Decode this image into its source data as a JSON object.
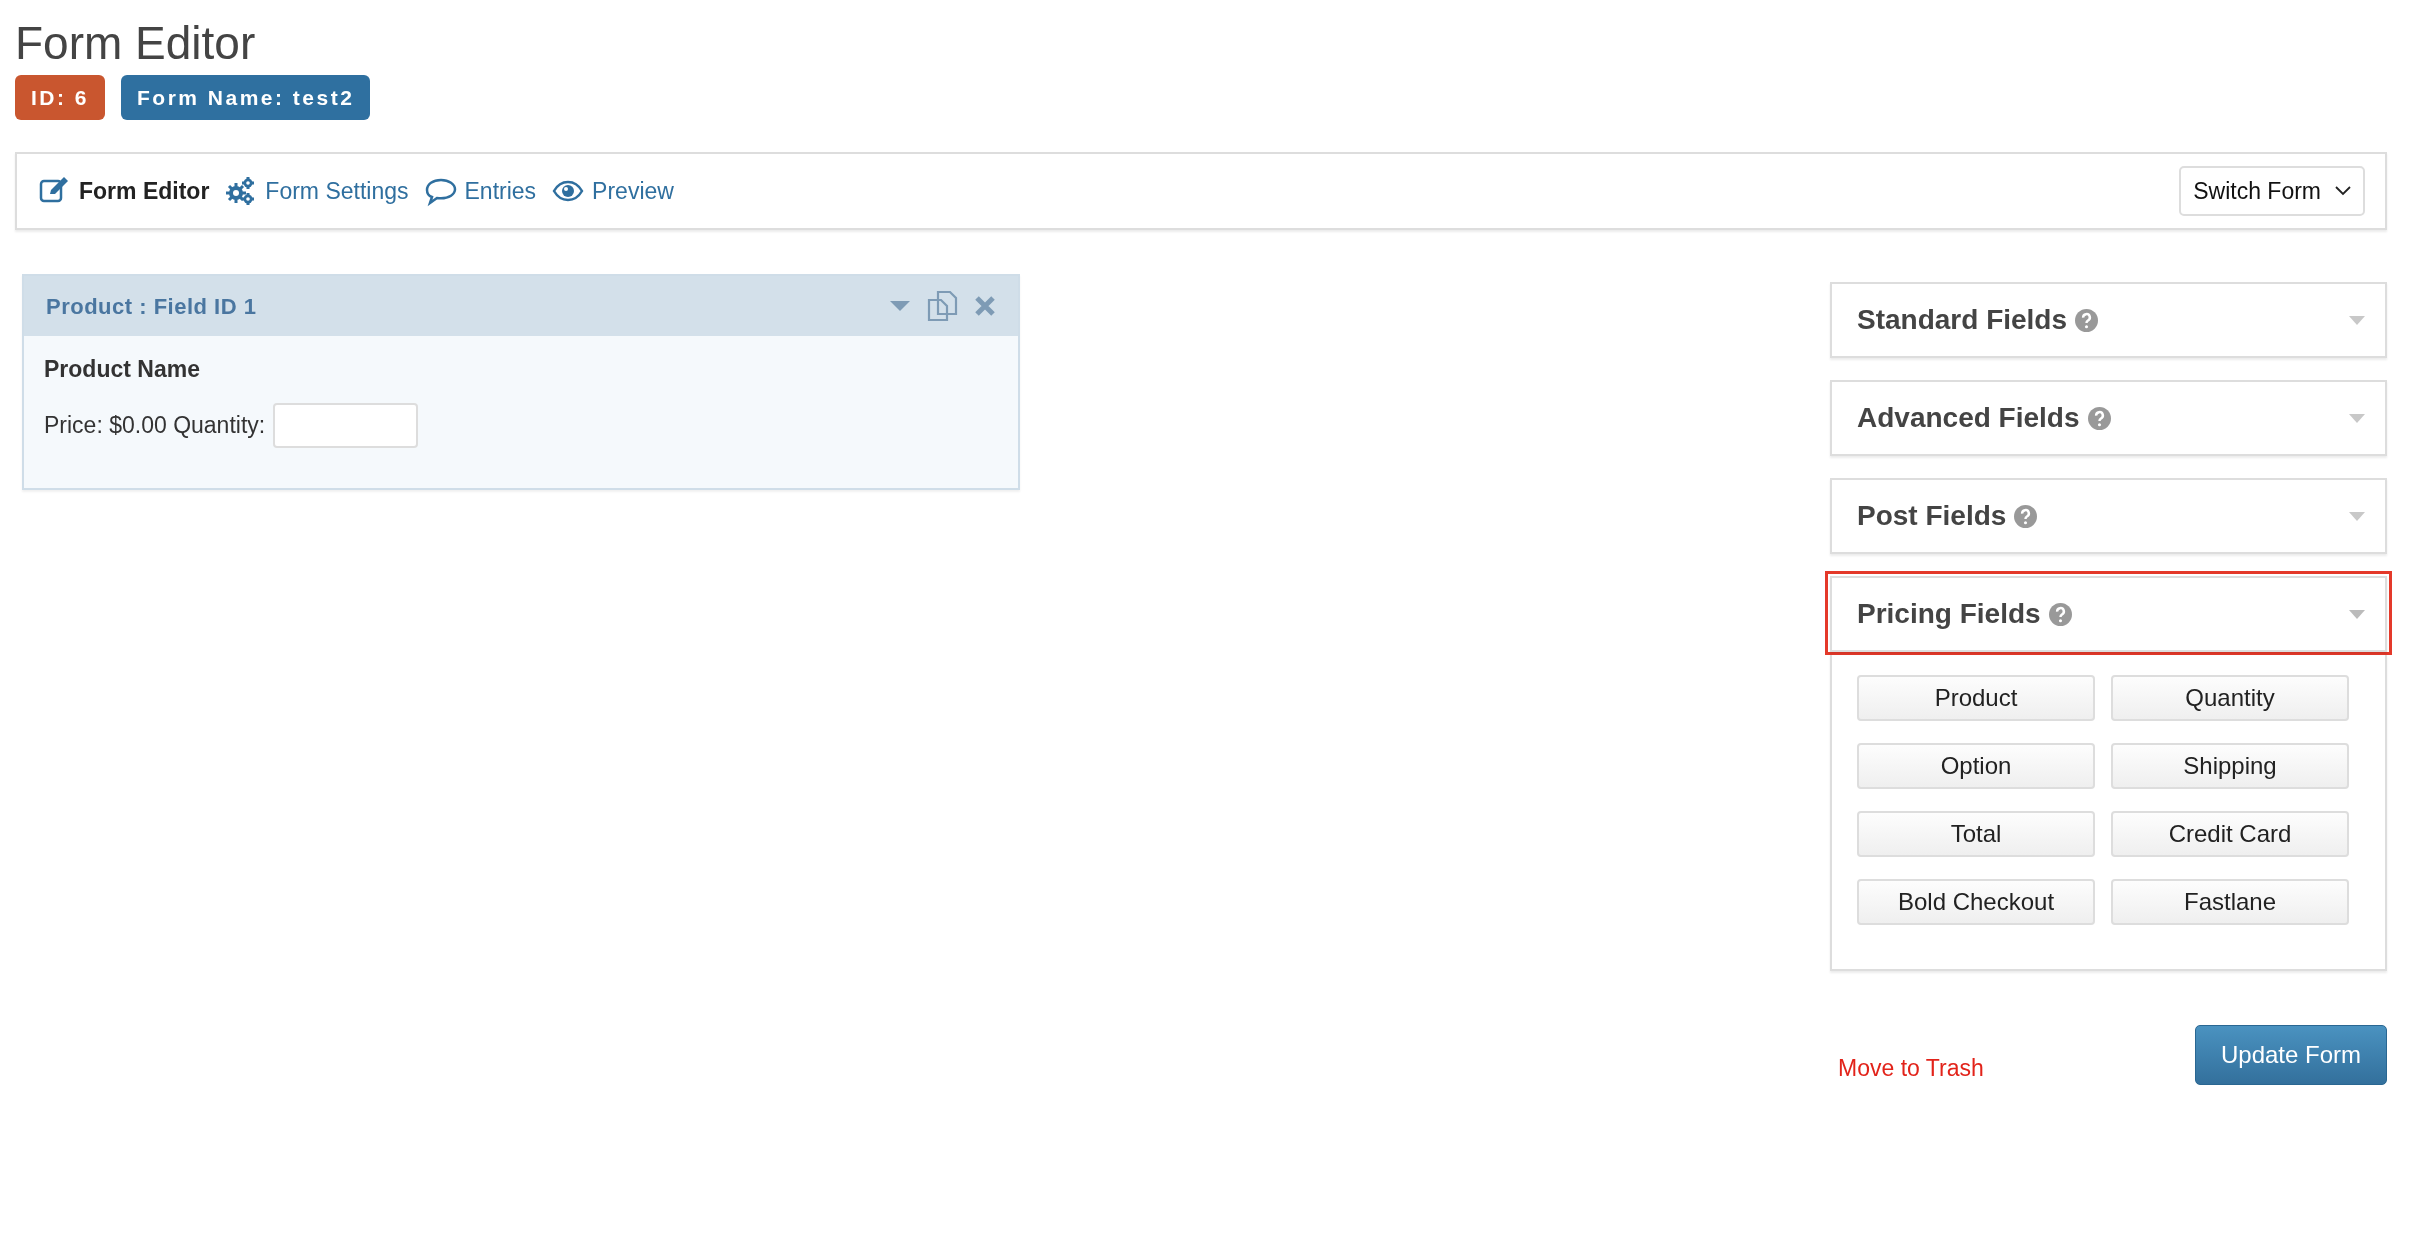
{
  "page": {
    "title": "Form Editor",
    "badges": [
      {
        "text": "ID: 6",
        "color": "#c9562f"
      },
      {
        "text": "Form Name: test2",
        "color": "#2f70a0"
      }
    ]
  },
  "toolbar": {
    "tabs": [
      {
        "kind": "editor",
        "label": "Form Editor",
        "selected": true
      },
      {
        "kind": "settings",
        "label": "Form Settings",
        "selected": false
      },
      {
        "kind": "entries",
        "label": "Entries",
        "selected": false
      },
      {
        "kind": "preview",
        "label": "Preview",
        "selected": false
      }
    ],
    "switch_form": "Switch Form"
  },
  "field_card": {
    "title": "Product : Field ID 1",
    "label": "Product Name",
    "price_text": "Price: $0.00 Quantity:"
  },
  "field_groups": [
    {
      "title": "Standard Fields",
      "expanded": false,
      "highlighted": false
    },
    {
      "title": "Advanced Fields",
      "expanded": false,
      "highlighted": false
    },
    {
      "title": "Post Fields",
      "expanded": false,
      "highlighted": false
    },
    {
      "title": "Pricing Fields",
      "expanded": true,
      "highlighted": true,
      "buttons": [
        "Product",
        "Quantity",
        "Option",
        "Shipping",
        "Total",
        "Credit Card",
        "Bold Checkout",
        "Fastlane"
      ]
    }
  ],
  "footer": {
    "trash_link": "Move to Trash",
    "update_button": "Update Form"
  }
}
